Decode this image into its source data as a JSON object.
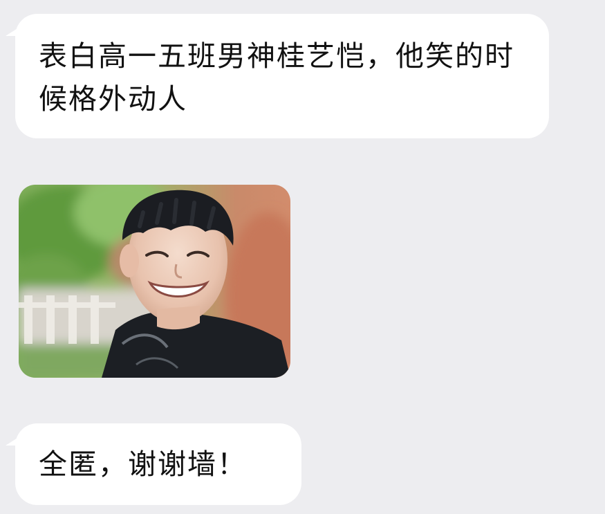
{
  "chat": {
    "messages": [
      {
        "type": "text",
        "text": "表白高一五班男神桂艺恺，他笑的时候格外动人"
      },
      {
        "type": "image"
      },
      {
        "type": "text",
        "text": "全匿，谢谢墙！"
      }
    ]
  },
  "colors": {
    "background": "#ededf0",
    "bubble": "#ffffff",
    "text": "#111111"
  }
}
